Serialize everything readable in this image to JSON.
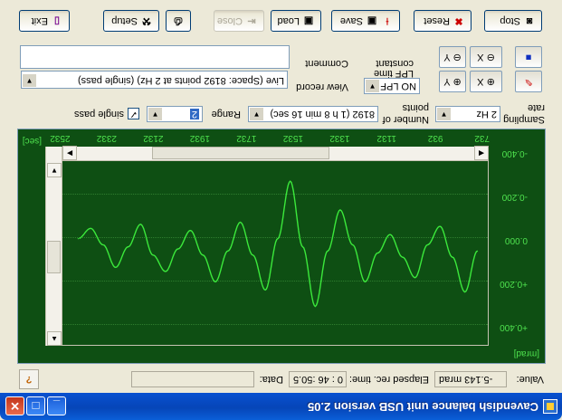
{
  "window": {
    "title": "Cavendish balance unit USB version 2.05",
    "controls": {
      "minimize": "_",
      "maximize": "□",
      "close": "✕"
    }
  },
  "status": {
    "value_label": "Value:",
    "value": "-5.143 mrad",
    "elapsed_label": "Elapsed rec. time:",
    "elapsed": "0 : 46 :50.5",
    "data_label": "Data:",
    "data_value": "",
    "help_icon": "help-question-icon"
  },
  "chart": {
    "y_unit": "[mrad]",
    "x_unit": "[sec]",
    "y_ticks": [
      "+0.400",
      "+0.200",
      "0.000",
      "-0.200",
      "-0.400"
    ],
    "x_ticks": [
      "732",
      "932",
      "1132",
      "1332",
      "1532",
      "1732",
      "1932",
      "2132",
      "2332",
      "2532"
    ],
    "line_color": "#3be83b",
    "background": "#0e4f13"
  },
  "chart_data": {
    "type": "line",
    "title": "",
    "xlabel": "[sec]",
    "ylabel": "[mrad]",
    "ylim": [
      -0.45,
      0.45
    ],
    "xlim": [
      650,
      2700
    ],
    "series": [
      {
        "values_description_free": true,
        "x": [
          700,
          760,
          820,
          880,
          940,
          1000,
          1060,
          1120,
          1180,
          1240,
          1300,
          1360,
          1420,
          1480,
          1540,
          1600,
          1660,
          1720,
          1780,
          1840,
          1900,
          1960,
          2020,
          2080,
          2140,
          2200,
          2260,
          2320,
          2380,
          2440,
          2500,
          2560,
          2620
        ],
        "y": [
          -0.01,
          -0.21,
          -0.04,
          0.11,
          0.02,
          -0.14,
          -0.04,
          0.07,
          -0.02,
          -0.16,
          0.02,
          0.19,
          -0.01,
          -0.28,
          0.01,
          0.33,
          0.05,
          -0.2,
          -0.03,
          0.13,
          -0.01,
          -0.16,
          -0.03,
          0.09,
          0.0,
          -0.11,
          -0.03,
          0.12,
          0.01,
          -0.09,
          0.02,
          0.1,
          0.05
        ]
      }
    ]
  },
  "params": {
    "sampling_label": "Sampling",
    "sampling_label2": "rate",
    "sampling_value": "2 Hz",
    "points_label": "Number of",
    "points_label2": "points",
    "points_value": "8192 (1 h 8 min 16 sec)",
    "range_label": "Range",
    "range_value": "2",
    "single_pass_label": "single pass",
    "single_pass_checked": "✓"
  },
  "record": {
    "view_label": "View record",
    "view_value": "Live (Space: 8192 points at 2 Hz) (single pass)",
    "lpf_label": "LPF time",
    "lpf_label2": "constant",
    "lpf_value": "NO LPF",
    "comment_label": "Comment",
    "comment_value": ""
  },
  "tools": {
    "cursor_y": "Y",
    "cursor_x": "X"
  },
  "toolbar": {
    "stop": "Stop",
    "reset": "Reset",
    "save": "Save",
    "load": "Load",
    "close": "Close",
    "setup": "Setup",
    "exit": "Exit"
  }
}
